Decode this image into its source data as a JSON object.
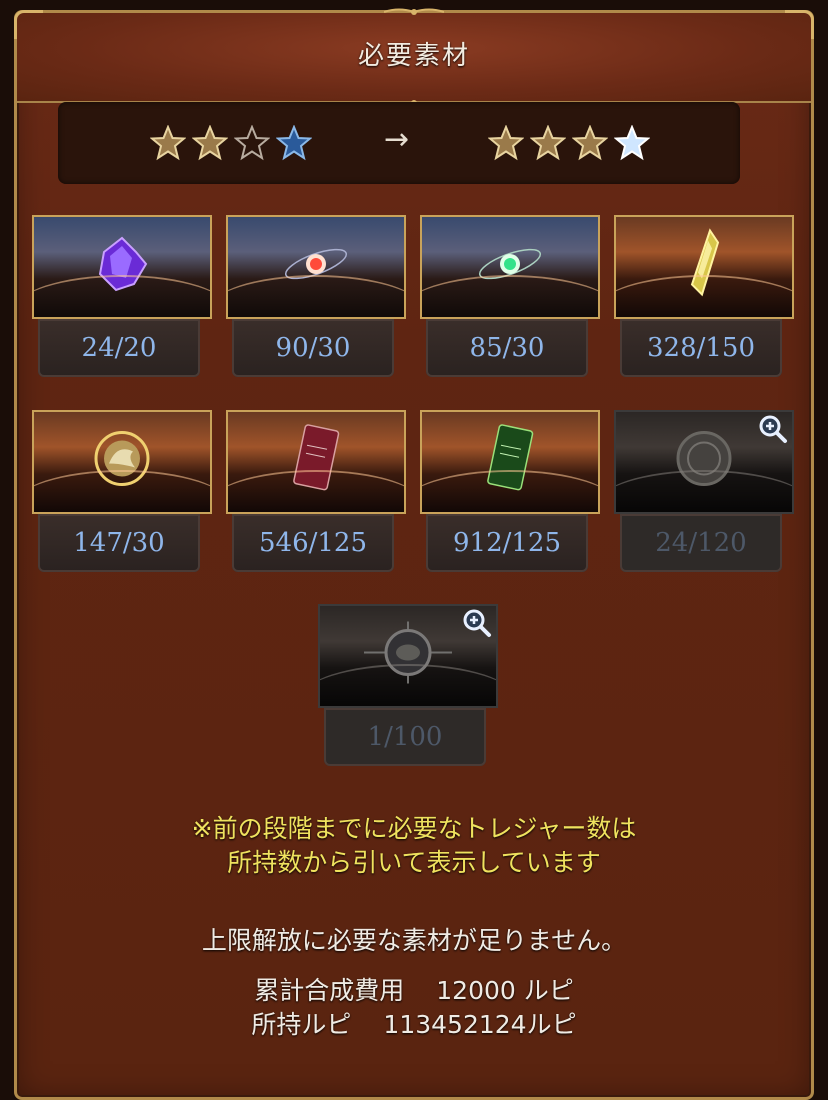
{
  "dialog": {
    "title": "必要素材"
  },
  "rank": {
    "arrow": "→",
    "from_stars": [
      "filled",
      "filled",
      "empty",
      "blue"
    ],
    "to_stars": [
      "filled",
      "filled",
      "filled",
      "white"
    ]
  },
  "materials": [
    {
      "name": "purple-crystal-icon",
      "count": "24/20",
      "enabled": true
    },
    {
      "name": "red-star-orb-icon",
      "count": "90/30",
      "enabled": true
    },
    {
      "name": "green-star-orb-icon",
      "count": "85/30",
      "enabled": true
    },
    {
      "name": "gold-crystal-icon",
      "count": "328/150",
      "enabled": true
    },
    {
      "name": "dragon-medal-icon",
      "count": "147/30",
      "enabled": true
    },
    {
      "name": "red-card-icon",
      "count": "546/125",
      "enabled": true
    },
    {
      "name": "green-card-icon",
      "count": "912/125",
      "enabled": true
    },
    {
      "name": "bronze-seal-icon",
      "count": "24/120",
      "enabled": false
    },
    {
      "name": "astral-medallion-icon",
      "count": "1/100",
      "enabled": false
    }
  ],
  "notice": {
    "line1": "※前の段階までに必要なトレジャー数は",
    "line2": "所持数から引いて表示しています"
  },
  "status": {
    "shortage": "上限解放に必要な素材が足りません。",
    "cost_label": "累計合成費用",
    "cost_value": "12000 ルピ",
    "owned_label": "所持ルピ",
    "owned_value": "113452124ルピ"
  },
  "colors": {
    "panel": "#5f2512",
    "frame_gold": "#c9a35a",
    "count_text": "#8fb6ea",
    "notice_text": "#efe25e"
  }
}
